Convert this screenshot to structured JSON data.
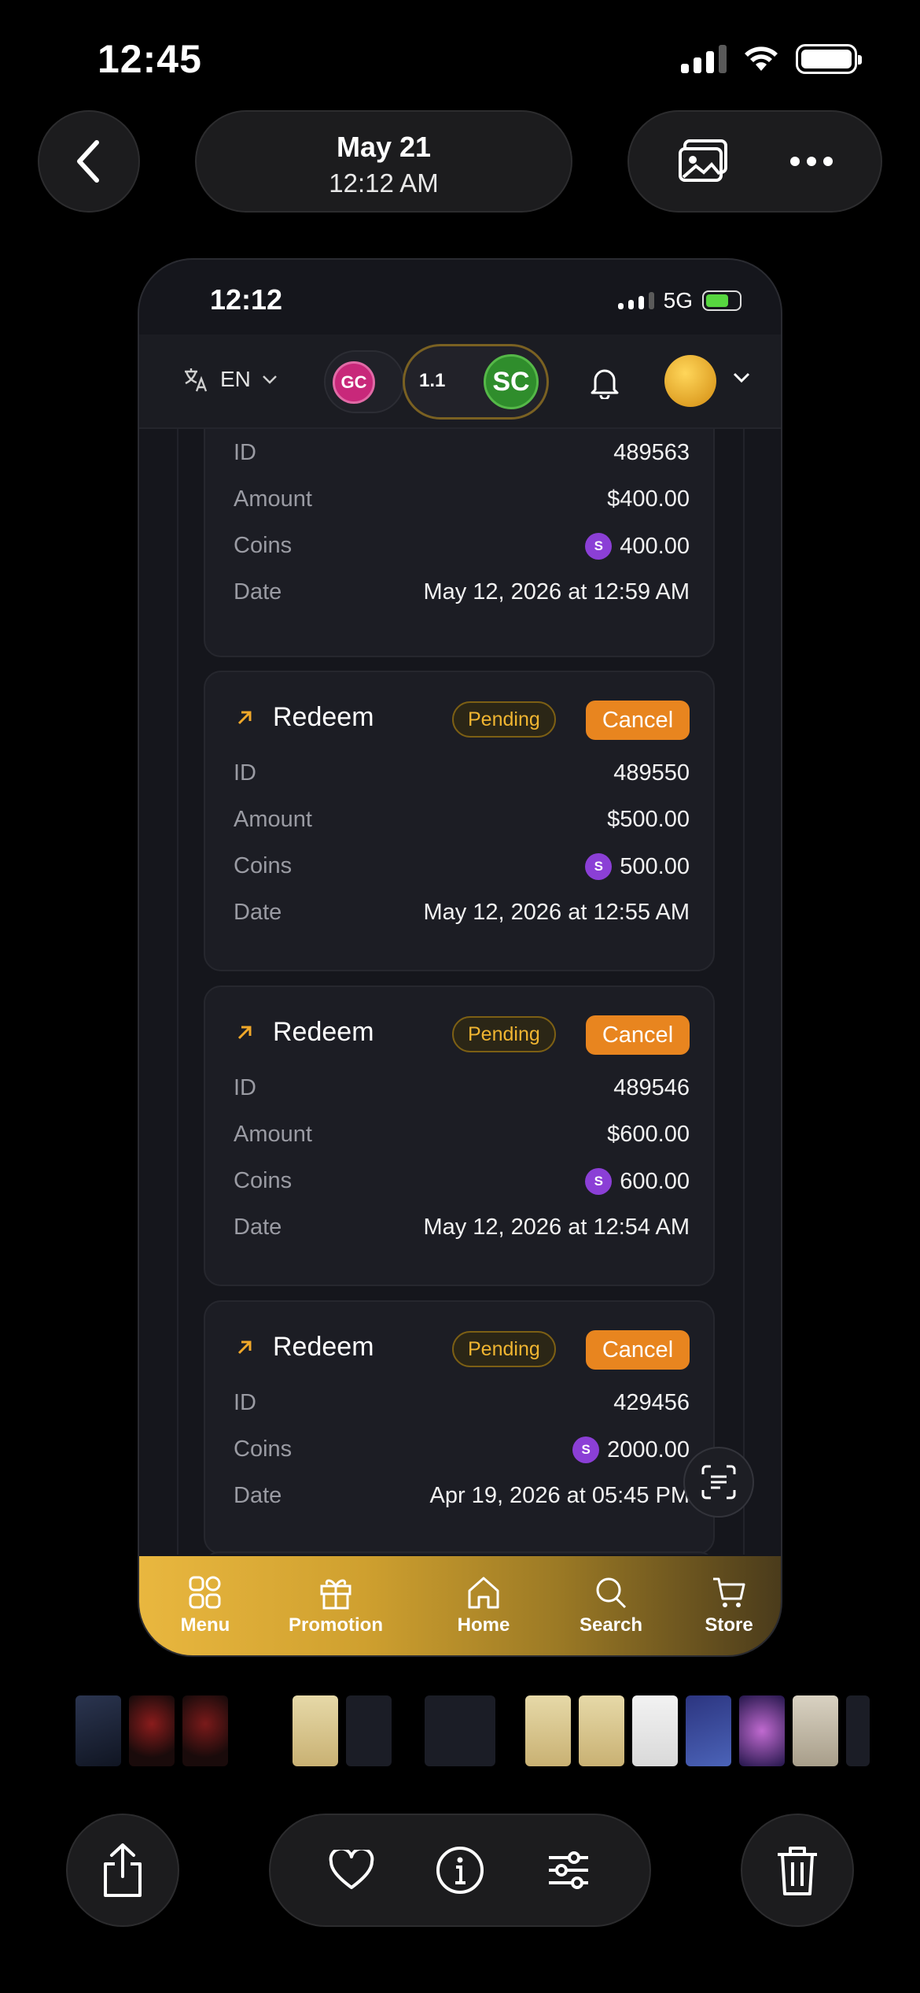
{
  "outer": {
    "status_time": "12:45",
    "date_title": "May 21",
    "date_time": "12:12 AM"
  },
  "inner": {
    "status_time": "12:12",
    "network": "5G",
    "language": "EN",
    "gc_label": "GC",
    "sc_label": "SC",
    "sc_balance": "1.1"
  },
  "coin_symbol": "S",
  "colors": {
    "accent": "#e8851f",
    "pending": "#f0b531",
    "coin": "#8b3fd6"
  },
  "transactions": [
    {
      "rows": [
        {
          "label": "ID",
          "value": "489563"
        },
        {
          "label": "Amount",
          "value": "$400.00"
        },
        {
          "label": "Coins",
          "value": "400.00"
        },
        {
          "label": "Date",
          "value": "May 12, 2026 at 12:59 AM"
        }
      ]
    },
    {
      "type": "Redeem",
      "status": "Pending",
      "action": "Cancel",
      "rows": [
        {
          "label": "ID",
          "value": "489550"
        },
        {
          "label": "Amount",
          "value": "$500.00"
        },
        {
          "label": "Coins",
          "value": "500.00"
        },
        {
          "label": "Date",
          "value": "May 12, 2026 at 12:55 AM"
        }
      ]
    },
    {
      "type": "Redeem",
      "status": "Pending",
      "action": "Cancel",
      "rows": [
        {
          "label": "ID",
          "value": "489546"
        },
        {
          "label": "Amount",
          "value": "$600.00"
        },
        {
          "label": "Coins",
          "value": "600.00"
        },
        {
          "label": "Date",
          "value": "May 12, 2026 at 12:54 AM"
        }
      ]
    },
    {
      "type": "Redeem",
      "status": "Pending",
      "action": "Cancel",
      "rows": [
        {
          "label": "ID",
          "value": "429456"
        },
        {
          "label": "Coins",
          "value": "2000.00"
        },
        {
          "label": "Date",
          "value": "Apr 19, 2026 at 05:45 PM"
        }
      ]
    }
  ],
  "tabs": [
    {
      "label": "Menu",
      "icon": "grid-icon"
    },
    {
      "label": "Promotion",
      "icon": "gift-icon"
    },
    {
      "label": "Home",
      "icon": "home-icon"
    },
    {
      "label": "Search",
      "icon": "search-icon"
    },
    {
      "label": "Store",
      "icon": "cart-icon"
    }
  ]
}
